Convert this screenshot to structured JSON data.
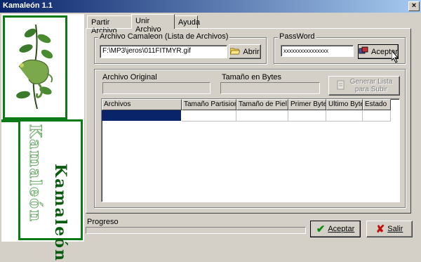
{
  "window": {
    "title": "Kamaleón 1.1"
  },
  "brand": {
    "logo_text_outline": "Kamaleón",
    "logo_text": "Kamaleón"
  },
  "tabs": [
    {
      "label": "Partir Archivo"
    },
    {
      "label": "Unir Archivo"
    },
    {
      "label": "Ayuda"
    }
  ],
  "archivo": {
    "group_label": "Archivo Camaleon (Lista de Archivos)",
    "path_value": "F:\\MP3\\jeros\\011FITMYR.gif",
    "open_button": "Abrir"
  },
  "password": {
    "group_label": "PassWord",
    "value": "xxxxxxxxxxxxxxxx",
    "accept_button": "Aceptar"
  },
  "info": {
    "original_label": "Archivo Original",
    "original_value": "",
    "size_label": "Tamaño en Bytes",
    "size_value": "",
    "generate_button_line1": "Generar Lista",
    "generate_button_line2": "para Subir"
  },
  "table": {
    "columns": [
      "Archivos",
      "Tamaño Partision",
      "Tamaño de Piel",
      "Primer Byte",
      "Ultimo Byte",
      "Estado"
    ]
  },
  "progress": {
    "label": "Progreso",
    "value": 0
  },
  "footer": {
    "accept_label": "Aceptar",
    "exit_label": "Salir"
  },
  "colors": {
    "title_start": "#0a246a",
    "title_end": "#a6caf0",
    "brand_green": "#0a7a16",
    "selection": "#0a246a"
  }
}
